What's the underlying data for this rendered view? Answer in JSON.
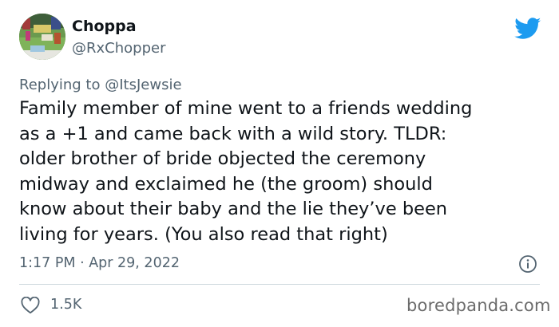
{
  "tweet": {
    "author": {
      "display_name": "Choppa",
      "handle": "@RxChopper",
      "avatar": "avatar-photo"
    },
    "replying_prefix": "Replying to",
    "replying_to": "@ItsJewsie",
    "text_lines": [
      "Family member of mine went to a friends wedding",
      "as a +1 and came back with a wild story. TLDR:",
      "older brother of bride objected the ceremony",
      "midway and exclaimed he (the groom) should",
      "know about their baby and the lie they’ve been",
      "living for years. (You also read that right)"
    ],
    "timestamp": "1:17 PM · Apr 29, 2022",
    "likes": "1.5K"
  },
  "icons": {
    "brand": "twitter-bird-icon",
    "info": "info-icon",
    "like": "heart-icon"
  },
  "watermark": "boredpanda.com",
  "colors": {
    "twitter_blue": "#1d9bf0",
    "text_primary": "#0f1419",
    "text_secondary": "#536471",
    "divider": "#cfd9de"
  }
}
